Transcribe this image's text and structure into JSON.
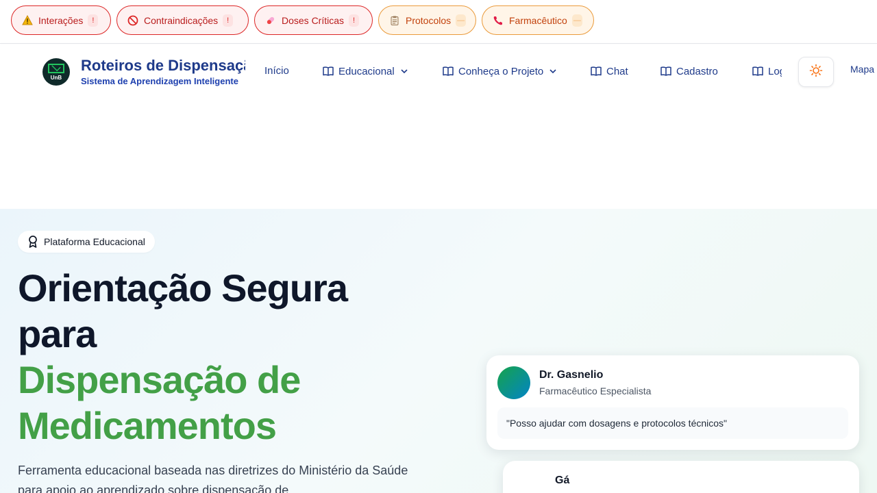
{
  "alerts": [
    {
      "label": "Interações",
      "badge": "!",
      "style": "red",
      "icon": "warning-icon"
    },
    {
      "label": "Contraindicações",
      "badge": "!",
      "style": "red",
      "icon": "prohibited-icon"
    },
    {
      "label": "Doses Críticas",
      "badge": "!",
      "style": "red",
      "icon": "pill-icon"
    },
    {
      "label": "Protocolos",
      "badge": "—",
      "style": "amber",
      "icon": "clipboard-icon"
    },
    {
      "label": "Farmacêutico",
      "badge": "—",
      "style": "amber",
      "icon": "phone-icon"
    }
  ],
  "header": {
    "logo_text": "UnB",
    "title": "Roteiros de Dispensação",
    "subtitle": "Sistema de Aprendizagem Inteligente"
  },
  "nav": {
    "items": [
      {
        "label": "Início"
      },
      {
        "label": "Educacional",
        "dropdown": true,
        "icon": "book-icon"
      },
      {
        "label": "Conheça o Projeto",
        "dropdown": true,
        "icon": "book-icon"
      },
      {
        "label": "Chat",
        "icon": "book-icon"
      },
      {
        "label": "Cadastro",
        "icon": "book-icon"
      },
      {
        "label": "Login",
        "icon": "book-icon"
      }
    ],
    "theme_icon": "sun-icon",
    "extra_link": "Mapa"
  },
  "hero": {
    "badge": "Plataforma Educacional",
    "title_line1": "Orientação Segura",
    "title_line2": "para",
    "title_line3": "Dispensação de",
    "title_line4": "Medicamentos",
    "lead": "Ferramenta educacional baseada nas diretrizes do Ministério da Saúde para apoio ao aprendizado sobre dispensação de",
    "card": {
      "name": "Dr. Gasnelio",
      "role": "Farmacêutico Especialista",
      "quote": "\"Posso ajudar com dosagens e protocolos técnicos\""
    },
    "card2": {
      "name": "Gá"
    }
  },
  "colors": {
    "brand_blue": "#1e3a8a",
    "green": "#43a047",
    "alert_red": "#dc2626",
    "alert_amber": "#ea9a3a"
  }
}
